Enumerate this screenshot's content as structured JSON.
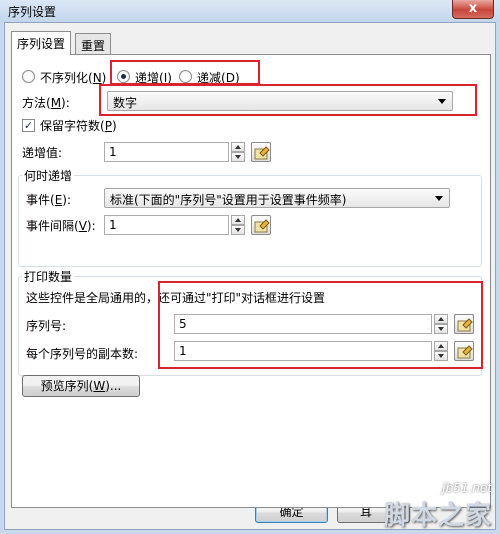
{
  "window": {
    "title": "序列设置",
    "close_glyph": "x"
  },
  "tabs": [
    {
      "label": "序列设置",
      "active": true
    },
    {
      "label": "重置",
      "active": false
    }
  ],
  "serial_mode": {
    "options": [
      {
        "label": "不序列化(",
        "key": "N",
        "suffix": ")",
        "checked": false
      },
      {
        "label": "递增(",
        "key": "I",
        "suffix": ")",
        "checked": true
      },
      {
        "label": "递减(",
        "key": "D",
        "suffix": ")",
        "checked": false
      }
    ]
  },
  "method": {
    "label": "方法(",
    "key": "M",
    "suffix": "):",
    "value": "数字"
  },
  "keep_digits": {
    "label": "保留字符数(",
    "key": "P",
    "suffix": ")",
    "checked": true,
    "check_glyph": "✓"
  },
  "increment": {
    "label": "递增值:",
    "value": "1"
  },
  "when_increment": {
    "title": "何时递增",
    "event_label": "事件(",
    "event_key": "E",
    "event_suffix": "):",
    "event_value": "标准(下面的\"序列号\"设置用于设置事件频率)",
    "interval_label": "事件间隔(",
    "interval_key": "V",
    "interval_suffix": "):",
    "interval_value": "1"
  },
  "print_quantity": {
    "title": "打印数量",
    "note": "这些控件是全局通用的，还可通过\"打印\"对话框进行设置",
    "serial_label": "序列号:",
    "serial_value": "5",
    "copies_label": "每个序列号的副本数:",
    "copies_value": "1"
  },
  "preview_button": {
    "label": "预览序列(",
    "key": "W",
    "suffix": ")..."
  },
  "footer": {
    "ok_label": "确定",
    "cancel_label_partial": "耳"
  },
  "watermark": {
    "site": "jb51.net",
    "brand": "脚本之家"
  },
  "colors": {
    "highlight_box": "#d9242e",
    "titlebar": "#c4d6ec"
  }
}
